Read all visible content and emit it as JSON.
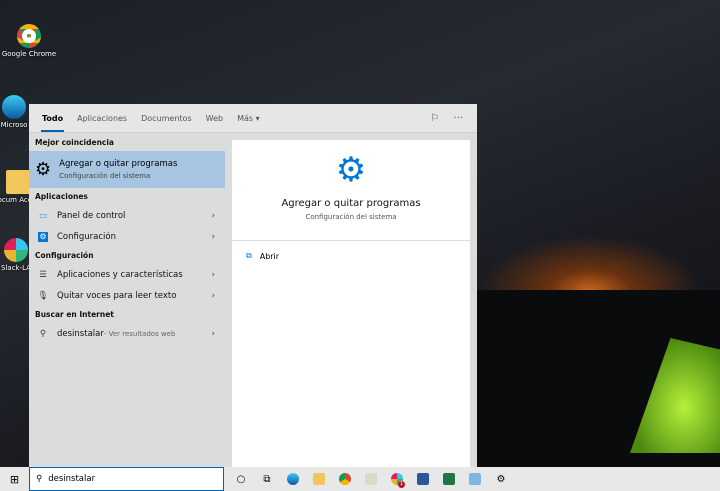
{
  "desktop": {
    "icons": [
      {
        "label": "Google Chrome"
      },
      {
        "label": "Microso"
      },
      {
        "label": "Docum Acceso"
      },
      {
        "label": "Slack-LA"
      }
    ]
  },
  "search_panel": {
    "tabs": [
      {
        "label": "Todo",
        "active": true
      },
      {
        "label": "Aplicaciones"
      },
      {
        "label": "Documentos"
      },
      {
        "label": "Web"
      },
      {
        "label": "Más ▾"
      }
    ],
    "sections": {
      "best": "Mejor coincidencia",
      "apps": "Aplicaciones",
      "settings": "Configuración",
      "web": "Buscar en Internet"
    },
    "best_match": {
      "title": "Agregar o quitar programas",
      "subtitle": "Configuración del sistema"
    },
    "apps": [
      {
        "label": "Panel de control"
      },
      {
        "label": "Configuración"
      }
    ],
    "settings": [
      {
        "label": "Aplicaciones y características"
      },
      {
        "label": "Quitar voces para leer texto"
      }
    ],
    "web": {
      "query": "desinstalar",
      "suffix": " - Ver resultados web"
    },
    "preview": {
      "title": "Agregar o quitar programas",
      "subtitle": "Configuración del sistema",
      "action": "Abrir"
    }
  },
  "taskbar": {
    "search_value": "desinstalar",
    "badge": "1"
  },
  "colors": {
    "accent": "#0063b1",
    "selection": "#a7c4e0"
  }
}
